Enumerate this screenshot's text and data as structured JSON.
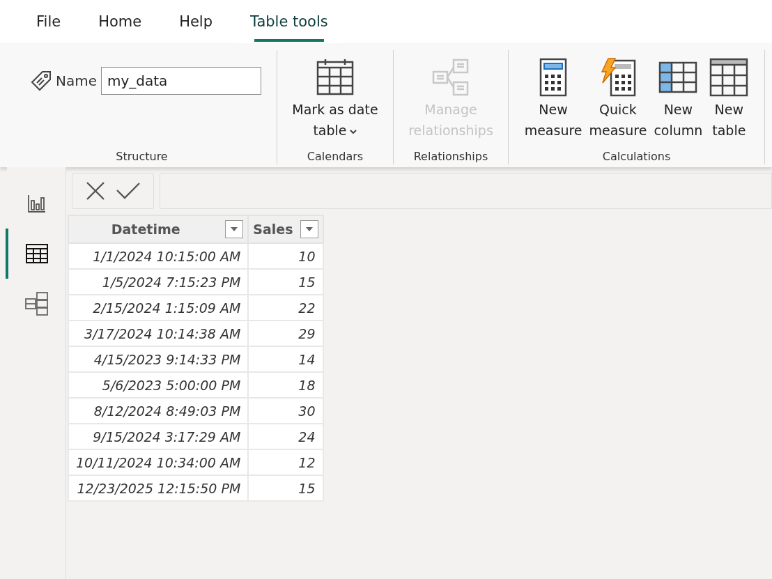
{
  "tabs": [
    {
      "label": "File",
      "selected": false
    },
    {
      "label": "Home",
      "selected": false
    },
    {
      "label": "Help",
      "selected": false
    },
    {
      "label": "Table tools",
      "selected": true
    }
  ],
  "ribbon": {
    "groups": [
      {
        "title": "Structure",
        "name_field": {
          "label": "Name",
          "value": "my_data"
        }
      },
      {
        "title": "Calendars",
        "buttons": [
          {
            "kind": "calendar",
            "lines": [
              "Mark as date",
              "table"
            ],
            "dropdown": true,
            "disabled": false
          }
        ]
      },
      {
        "title": "Relationships",
        "buttons": [
          {
            "kind": "relationships",
            "lines": [
              "Manage",
              "relationships"
            ],
            "dropdown": false,
            "disabled": true
          }
        ]
      },
      {
        "title": "Calculations",
        "buttons": [
          {
            "kind": "measure",
            "lines": [
              "New",
              "measure"
            ],
            "dropdown": false,
            "disabled": false
          },
          {
            "kind": "quick-measure",
            "lines": [
              "Quick",
              "measure"
            ],
            "dropdown": false,
            "disabled": false
          },
          {
            "kind": "column",
            "lines": [
              "New",
              "column"
            ],
            "dropdown": false,
            "disabled": false
          },
          {
            "kind": "table",
            "lines": [
              "New",
              "table"
            ],
            "dropdown": false,
            "disabled": false
          }
        ]
      }
    ]
  },
  "nav": [
    {
      "kind": "report",
      "selected": false
    },
    {
      "kind": "table",
      "selected": true
    },
    {
      "kind": "model",
      "selected": false
    }
  ],
  "table": {
    "columns": [
      "Datetime",
      "Sales"
    ],
    "rows": [
      [
        "1/1/2024 10:15:00 AM",
        "10"
      ],
      [
        "1/5/2024 7:15:23 PM",
        "15"
      ],
      [
        "2/15/2024 1:15:09 AM",
        "22"
      ],
      [
        "3/17/2024 10:14:38 AM",
        "29"
      ],
      [
        "4/15/2023 9:14:33 PM",
        "14"
      ],
      [
        "5/6/2023 5:00:00 PM",
        "18"
      ],
      [
        "8/12/2024 8:49:03 PM",
        "30"
      ],
      [
        "9/15/2024 3:17:29 AM",
        "24"
      ],
      [
        "10/11/2024 10:34:00 AM",
        "12"
      ],
      [
        "12/23/2025 12:15:50 PM",
        "15"
      ]
    ]
  }
}
